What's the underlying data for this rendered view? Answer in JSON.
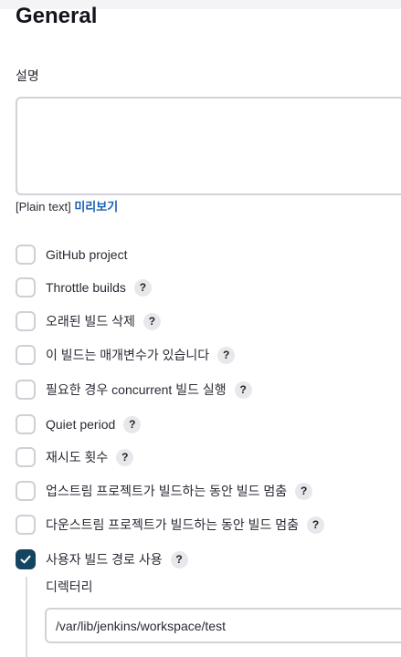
{
  "section": {
    "title": "General"
  },
  "description": {
    "label": "설명",
    "value": ""
  },
  "format": {
    "prefix": "[Plain text]",
    "preview_label": "미리보기"
  },
  "options": [
    {
      "label": "GitHub project",
      "checked": false,
      "help": ""
    },
    {
      "label": "Throttle builds",
      "checked": false,
      "help": "?"
    },
    {
      "label": "오래된 빌드 삭제",
      "checked": false,
      "help": "?"
    },
    {
      "label": "이 빌드는 매개변수가 있습니다",
      "checked": false,
      "help": "?"
    },
    {
      "label": "필요한 경우 concurrent 빌드 실행",
      "checked": false,
      "help": "?"
    },
    {
      "label": "Quiet period",
      "checked": false,
      "help": "?"
    },
    {
      "label": "재시도 횟수",
      "checked": false,
      "help": "?"
    },
    {
      "label": "업스트림 프로젝트가 빌드하는 동안 빌드 멈춤",
      "checked": false,
      "help": "?"
    },
    {
      "label": "다운스트림 프로젝트가 빌드하는 동안 빌드 멈춤",
      "checked": false,
      "help": "?"
    },
    {
      "label": "사용자 빌드 경로 사용",
      "checked": true,
      "help": "?"
    }
  ],
  "custom_workspace": {
    "directory_label": "디렉터리",
    "directory_value": "/var/lib/jenkins/workspace/test"
  },
  "colors": {
    "accent_checked": "#14445f",
    "link": "#1a5fb4"
  }
}
